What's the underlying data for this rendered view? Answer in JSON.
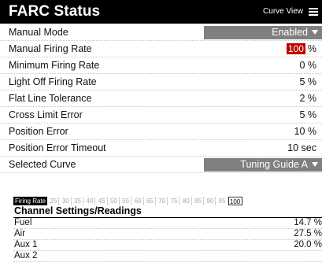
{
  "header": {
    "title": "FARC Status",
    "curve_view": "Curve View"
  },
  "settings": [
    {
      "label": "Manual Mode",
      "type": "select",
      "value": "Enabled"
    },
    {
      "label": "Manual Firing Rate",
      "type": "highlight",
      "value": "100",
      "unit": "%"
    },
    {
      "label": "Minimum Firing Rate",
      "value": "0 %"
    },
    {
      "label": "Light Off Firing Rate",
      "value": "5 %"
    },
    {
      "label": "Flat Line Tolerance",
      "value": "2 %"
    },
    {
      "label": "Cross Limit Error",
      "value": "5 %"
    },
    {
      "label": "Position Error",
      "value": "10 %"
    },
    {
      "label": "Position Error Timeout",
      "value": "10 sec"
    },
    {
      "label": "Selected Curve",
      "type": "select",
      "value": "Tuning Guide A"
    }
  ],
  "scale": {
    "label": "Firing Rate",
    "ticks": [
      "25",
      "30",
      "35",
      "40",
      "45",
      "50",
      "55",
      "60",
      "65",
      "70",
      "75",
      "80",
      "85",
      "90",
      "95"
    ],
    "current": "100"
  },
  "channels": {
    "title": "Channel Settings/Readings",
    "rows": [
      {
        "label": "Fuel",
        "value": "14.7 %"
      },
      {
        "label": "Air",
        "value": "27.5 %"
      },
      {
        "label": "Aux 1",
        "value": "20.0 %"
      },
      {
        "label": "Aux 2",
        "value": ""
      }
    ]
  }
}
